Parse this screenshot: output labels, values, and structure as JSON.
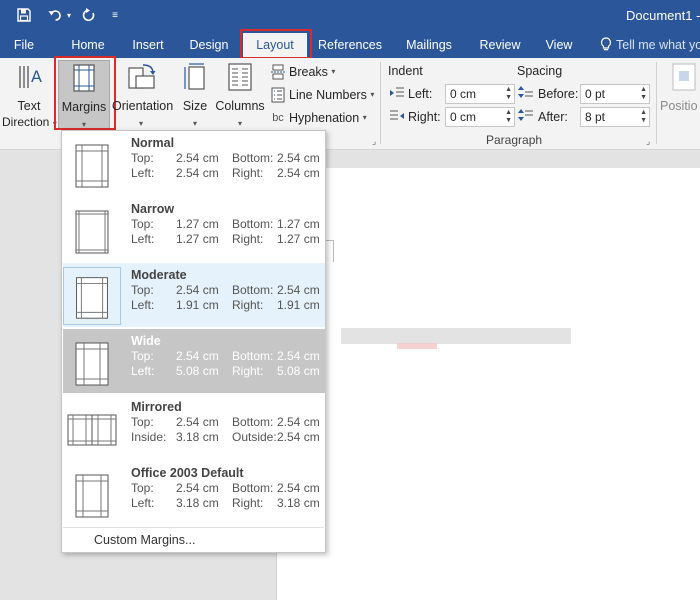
{
  "app": {
    "document_title": "Document1 -"
  },
  "tabs": [
    {
      "label": "File"
    },
    {
      "label": "Home"
    },
    {
      "label": "Insert"
    },
    {
      "label": "Design"
    },
    {
      "label": "Layout"
    },
    {
      "label": "References"
    },
    {
      "label": "Mailings"
    },
    {
      "label": "Review"
    },
    {
      "label": "View"
    },
    {
      "label": "Tell me what yo"
    }
  ],
  "ribbon": {
    "text_direction": {
      "line1": "Text",
      "line2": "Direction"
    },
    "margins_label": "Margins",
    "orientation_label": "Orientation",
    "size_label": "Size",
    "columns_label": "Columns",
    "breaks_label": "Breaks",
    "line_numbers_label": "Line Numbers",
    "hyphenation_label": "Hyphenation",
    "indent": {
      "title": "Indent",
      "left_label": "Left:",
      "left_value": "0 cm",
      "right_label": "Right:",
      "right_value": "0 cm"
    },
    "spacing": {
      "title": "Spacing",
      "before_label": "Before:",
      "before_value": "0 pt",
      "after_label": "After:",
      "after_value": "8 pt"
    },
    "paragraph_group": "Paragraph",
    "position_label": "Positio"
  },
  "margins_menu": {
    "items": [
      {
        "name": "Normal",
        "r1": [
          "Top:",
          "2.54 cm",
          "Bottom:",
          "2.54 cm"
        ],
        "r2": [
          "Left:",
          "2.54 cm",
          "Right:",
          "2.54 cm"
        ]
      },
      {
        "name": "Narrow",
        "r1": [
          "Top:",
          "1.27 cm",
          "Bottom:",
          "1.27 cm"
        ],
        "r2": [
          "Left:",
          "1.27 cm",
          "Right:",
          "1.27 cm"
        ]
      },
      {
        "name": "Moderate",
        "r1": [
          "Top:",
          "2.54 cm",
          "Bottom:",
          "2.54 cm"
        ],
        "r2": [
          "Left:",
          "1.91 cm",
          "Right:",
          "1.91 cm"
        ]
      },
      {
        "name": "Wide",
        "r1": [
          "Top:",
          "2.54 cm",
          "Bottom:",
          "2.54 cm"
        ],
        "r2": [
          "Left:",
          "5.08 cm",
          "Right:",
          "5.08 cm"
        ]
      },
      {
        "name": "Mirrored",
        "r1": [
          "Top:",
          "2.54 cm",
          "Bottom:",
          "2.54 cm"
        ],
        "r2": [
          "Inside:",
          "3.18 cm",
          "Outside:",
          "2.54 cm"
        ]
      },
      {
        "name": "Office 2003 Default",
        "r1": [
          "Top:",
          "2.54 cm",
          "Bottom:",
          "2.54 cm"
        ],
        "r2": [
          "Left:",
          "3.18 cm",
          "Right:",
          "3.18 cm"
        ]
      }
    ],
    "custom_label": "Custom Margins..."
  },
  "colors": {
    "brand": "#2b579a",
    "highlight_box": "#d62c2c",
    "selected_item": "#c6c6c6",
    "hover_item": "#e5f1fb"
  }
}
